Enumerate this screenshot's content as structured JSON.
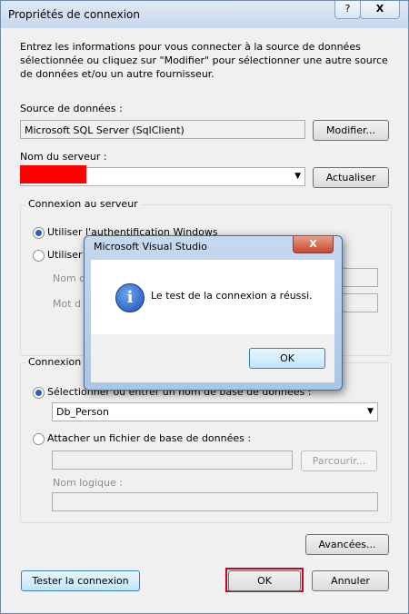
{
  "window": {
    "title": "Propriétés de connexion",
    "help_glyph": "?",
    "close_glyph": "X"
  },
  "instructions": "Entrez les informations pour vous connecter à la source de données sélectionnée ou cliquez sur \"Modifier\" pour sélectionner une autre source de données et/ou un autre fournisseur.",
  "datasource": {
    "label": "Source de données :",
    "value": "Microsoft SQL Server (SqlClient)",
    "modify_button": "Modifier..."
  },
  "server": {
    "label": "Nom du serveur :",
    "value": "",
    "refresh_button": "Actualiser"
  },
  "server_connection": {
    "legend": "Connexion au serveur",
    "option_windows": "Utiliser l'authentification Windows",
    "option_sql": "Utiliser",
    "username_label": "Nom d",
    "password_label": "Mot d",
    "selected": "windows"
  },
  "database_connection": {
    "legend": "Connexion",
    "option_select": "Sélectionner ou entrer un nom de base de données :",
    "database_value": "Db_Person",
    "option_attach": "Attacher un fichier de base de données :",
    "browse_button": "Parcourir...",
    "logical_name_label": "Nom logique :",
    "selected": "select"
  },
  "footer": {
    "advanced_button": "Avancées...",
    "test_button": "Tester la connexion",
    "ok_button": "OK",
    "cancel_button": "Annuler"
  },
  "dialog": {
    "title": "Microsoft Visual Studio",
    "close_glyph": "X",
    "icon": "info-icon",
    "message": "Le test de la connexion a réussi.",
    "ok_button": "OK"
  },
  "colors": {
    "redaction": "#ff0000",
    "highlight_border": "#d0021b"
  }
}
